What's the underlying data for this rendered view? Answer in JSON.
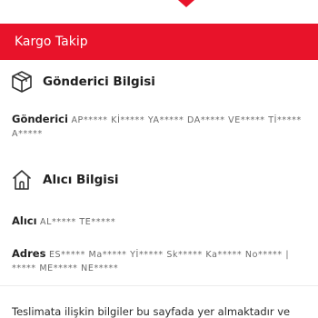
{
  "header": {
    "title": "Kargo Takip",
    "brand_color": "#e8132a"
  },
  "sender_section": {
    "icon": "package-icon",
    "title": "Gönderici Bilgisi",
    "sender_label": "Gönderici",
    "sender_value": "AP***** Kİ***** YA***** DA***** VE***** Tİ***** A*****"
  },
  "recipient_section": {
    "icon": "house-icon",
    "title": "Alıcı Bilgisi",
    "recipient_label": "Alıcı",
    "recipient_value": "AL***** TE*****",
    "address_label": "Adres",
    "address_value": "ES***** Ma***** Yİ***** Sk***** Ka***** No***** | ***** ME***** NE*****"
  },
  "footer_note": "Teslimata ilişkin bilgiler bu sayfada yer almaktadır ve"
}
